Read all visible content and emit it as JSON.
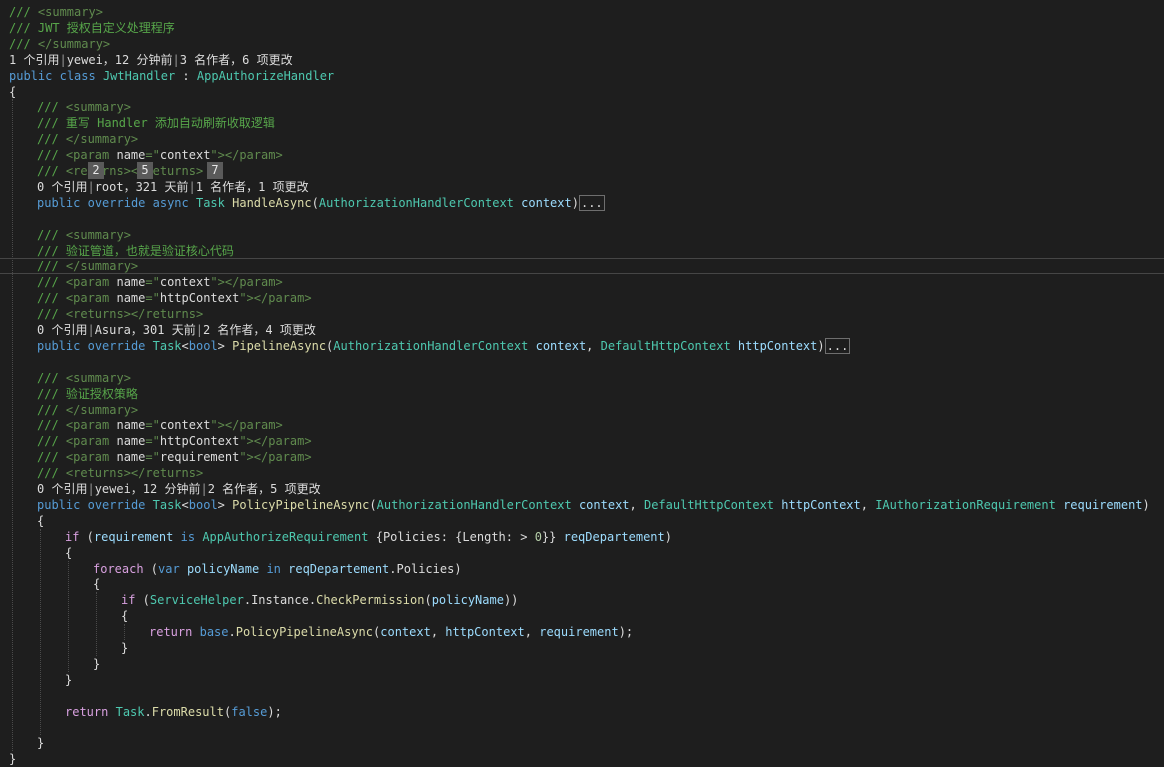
{
  "editor": {
    "lines": [
      {
        "indent": 0,
        "tokens": [
          [
            "/// ",
            "comment"
          ],
          [
            "<summary>",
            "xml"
          ]
        ]
      },
      {
        "indent": 0,
        "tokens": [
          [
            "/// JWT 授权自定义处理程序",
            "comment"
          ]
        ]
      },
      {
        "indent": 0,
        "tokens": [
          [
            "/// ",
            "comment"
          ],
          [
            "</summary>",
            "xml"
          ]
        ]
      },
      {
        "indent": 0,
        "lens": true,
        "tokens": [
          [
            "1 个引用",
            "lens"
          ],
          [
            "|",
            "sep"
          ],
          [
            "yewei，12 分钟前",
            "lens"
          ],
          [
            "|",
            "sep"
          ],
          [
            "3 名作者，6 项更改",
            "lens"
          ]
        ]
      },
      {
        "indent": 0,
        "tokens": [
          [
            "public",
            "kw"
          ],
          [
            " ",
            "plain"
          ],
          [
            "class",
            "kw"
          ],
          [
            " ",
            "plain"
          ],
          [
            "JwtHandler",
            "type"
          ],
          [
            " : ",
            "plain"
          ],
          [
            "AppAuthorizeHandler",
            "type"
          ]
        ]
      },
      {
        "indent": 0,
        "tokens": [
          [
            "{",
            "plain"
          ]
        ]
      },
      {
        "indent": 1,
        "tokens": [
          [
            "/// ",
            "comment"
          ],
          [
            "<summary>",
            "xml"
          ]
        ]
      },
      {
        "indent": 1,
        "tokens": [
          [
            "/// 重写 Handler 添加自动刷新收取逻辑",
            "comment"
          ]
        ]
      },
      {
        "indent": 1,
        "tokens": [
          [
            "/// ",
            "comment"
          ],
          [
            "</summary>",
            "xml"
          ]
        ]
      },
      {
        "indent": 1,
        "tokens": [
          [
            "/// ",
            "comment"
          ],
          [
            "<param ",
            "xml"
          ],
          [
            "name",
            "plain"
          ],
          [
            "=\"",
            "xml"
          ],
          [
            "context",
            "plain"
          ],
          [
            "\"></param>",
            "xml"
          ]
        ]
      },
      {
        "indent": 1,
        "tokens": [
          [
            "/// ",
            "comment"
          ],
          [
            "<returns></returns>",
            "xml"
          ]
        ]
      },
      {
        "indent": 1,
        "lens": true,
        "tokens": [
          [
            "0 个引用",
            "lens"
          ],
          [
            "|",
            "sep"
          ],
          [
            "root，321 天前",
            "lens"
          ],
          [
            "|",
            "sep"
          ],
          [
            "1 名作者，1 项更改",
            "lens"
          ]
        ]
      },
      {
        "indent": 1,
        "tokens": [
          [
            "public",
            "kw"
          ],
          [
            " ",
            "plain"
          ],
          [
            "override",
            "kw"
          ],
          [
            " ",
            "plain"
          ],
          [
            "async",
            "kw"
          ],
          [
            " ",
            "plain"
          ],
          [
            "Task",
            "type"
          ],
          [
            " ",
            "plain"
          ],
          [
            "HandleAsync",
            "method"
          ],
          [
            "(",
            "plain"
          ],
          [
            "AuthorizationHandlerContext",
            "type"
          ],
          [
            " ",
            "plain"
          ],
          [
            "context",
            "var"
          ],
          [
            ")",
            "plain"
          ],
          [
            "...",
            "fold"
          ]
        ]
      },
      {
        "indent": 0,
        "tokens": []
      },
      {
        "indent": 1,
        "tokens": [
          [
            "/// ",
            "comment"
          ],
          [
            "<summary>",
            "xml"
          ]
        ]
      },
      {
        "indent": 1,
        "tokens": [
          [
            "/// 验证管道，也就是验证核心代码",
            "comment"
          ]
        ]
      },
      {
        "indent": 1,
        "highlight": true,
        "tokens": [
          [
            "/// ",
            "comment"
          ],
          [
            "</summary>",
            "xml"
          ]
        ]
      },
      {
        "indent": 1,
        "tokens": [
          [
            "/// ",
            "comment"
          ],
          [
            "<param ",
            "xml"
          ],
          [
            "name",
            "plain"
          ],
          [
            "=\"",
            "xml"
          ],
          [
            "context",
            "plain"
          ],
          [
            "\"></param>",
            "xml"
          ]
        ]
      },
      {
        "indent": 1,
        "tokens": [
          [
            "/// ",
            "comment"
          ],
          [
            "<param ",
            "xml"
          ],
          [
            "name",
            "plain"
          ],
          [
            "=\"",
            "xml"
          ],
          [
            "httpContext",
            "plain"
          ],
          [
            "\"></param>",
            "xml"
          ]
        ]
      },
      {
        "indent": 1,
        "tokens": [
          [
            "/// ",
            "comment"
          ],
          [
            "<returns></returns>",
            "xml"
          ]
        ]
      },
      {
        "indent": 1,
        "lens": true,
        "tokens": [
          [
            "0 个引用",
            "lens"
          ],
          [
            "|",
            "sep"
          ],
          [
            "Asura，301 天前",
            "lens"
          ],
          [
            "|",
            "sep"
          ],
          [
            "2 名作者，4 项更改",
            "lens"
          ]
        ]
      },
      {
        "indent": 1,
        "tokens": [
          [
            "public",
            "kw"
          ],
          [
            " ",
            "plain"
          ],
          [
            "override",
            "kw"
          ],
          [
            " ",
            "plain"
          ],
          [
            "Task",
            "type"
          ],
          [
            "<",
            "plain"
          ],
          [
            "bool",
            "kw"
          ],
          [
            "> ",
            "plain"
          ],
          [
            "PipelineAsync",
            "method"
          ],
          [
            "(",
            "plain"
          ],
          [
            "AuthorizationHandlerContext",
            "type"
          ],
          [
            " ",
            "plain"
          ],
          [
            "context",
            "var"
          ],
          [
            ", ",
            "plain"
          ],
          [
            "DefaultHttpContext",
            "type"
          ],
          [
            " ",
            "plain"
          ],
          [
            "httpContext",
            "var"
          ],
          [
            ")",
            "plain"
          ],
          [
            "...",
            "fold"
          ]
        ]
      },
      {
        "indent": 0,
        "tokens": []
      },
      {
        "indent": 1,
        "tokens": [
          [
            "/// ",
            "comment"
          ],
          [
            "<summary>",
            "xml"
          ]
        ]
      },
      {
        "indent": 1,
        "tokens": [
          [
            "/// 验证授权策略",
            "comment"
          ]
        ]
      },
      {
        "indent": 1,
        "tokens": [
          [
            "/// ",
            "comment"
          ],
          [
            "</summary>",
            "xml"
          ]
        ]
      },
      {
        "indent": 1,
        "tokens": [
          [
            "/// ",
            "comment"
          ],
          [
            "<param ",
            "xml"
          ],
          [
            "name",
            "plain"
          ],
          [
            "=\"",
            "xml"
          ],
          [
            "context",
            "plain"
          ],
          [
            "\"></param>",
            "xml"
          ]
        ]
      },
      {
        "indent": 1,
        "tokens": [
          [
            "/// ",
            "comment"
          ],
          [
            "<param ",
            "xml"
          ],
          [
            "name",
            "plain"
          ],
          [
            "=\"",
            "xml"
          ],
          [
            "httpContext",
            "plain"
          ],
          [
            "\"></param>",
            "xml"
          ]
        ]
      },
      {
        "indent": 1,
        "tokens": [
          [
            "/// ",
            "comment"
          ],
          [
            "<param ",
            "xml"
          ],
          [
            "name",
            "plain"
          ],
          [
            "=\"",
            "xml"
          ],
          [
            "requirement",
            "plain"
          ],
          [
            "\"></param>",
            "xml"
          ]
        ]
      },
      {
        "indent": 1,
        "tokens": [
          [
            "/// ",
            "comment"
          ],
          [
            "<returns></returns>",
            "xml"
          ]
        ]
      },
      {
        "indent": 1,
        "lens": true,
        "tokens": [
          [
            "0 个引用",
            "lens"
          ],
          [
            "|",
            "sep"
          ],
          [
            "yewei，12 分钟前",
            "lens"
          ],
          [
            "|",
            "sep"
          ],
          [
            "2 名作者，5 项更改",
            "lens"
          ]
        ]
      },
      {
        "indent": 1,
        "tokens": [
          [
            "public",
            "kw"
          ],
          [
            " ",
            "plain"
          ],
          [
            "override",
            "kw"
          ],
          [
            " ",
            "plain"
          ],
          [
            "Task",
            "type"
          ],
          [
            "<",
            "plain"
          ],
          [
            "bool",
            "kw"
          ],
          [
            "> ",
            "plain"
          ],
          [
            "PolicyPipelineAsync",
            "method"
          ],
          [
            "(",
            "plain"
          ],
          [
            "AuthorizationHandlerContext",
            "type"
          ],
          [
            " ",
            "plain"
          ],
          [
            "context",
            "var"
          ],
          [
            ", ",
            "plain"
          ],
          [
            "DefaultHttpContext",
            "type"
          ],
          [
            " ",
            "plain"
          ],
          [
            "httpContext",
            "var"
          ],
          [
            ", ",
            "plain"
          ],
          [
            "IAuthorizationRequirement",
            "type"
          ],
          [
            " ",
            "plain"
          ],
          [
            "requirement",
            "var"
          ],
          [
            ")",
            "plain"
          ]
        ]
      },
      {
        "indent": 1,
        "tokens": [
          [
            "{",
            "plain"
          ]
        ]
      },
      {
        "indent": 2,
        "tokens": [
          [
            "if",
            "ctl"
          ],
          [
            " (",
            "plain"
          ],
          [
            "requirement",
            "var"
          ],
          [
            " ",
            "plain"
          ],
          [
            "is",
            "kw"
          ],
          [
            " ",
            "plain"
          ],
          [
            "AppAuthorizeRequirement",
            "type"
          ],
          [
            " {",
            "plain"
          ],
          [
            "Policies",
            "plain"
          ],
          [
            ": {",
            "plain"
          ],
          [
            "Length",
            "plain"
          ],
          [
            ": > ",
            "plain"
          ],
          [
            "0",
            "num"
          ],
          [
            "}} ",
            "plain"
          ],
          [
            "reqDepartement",
            "var"
          ],
          [
            ")",
            "plain"
          ]
        ]
      },
      {
        "indent": 2,
        "tokens": [
          [
            "{",
            "plain"
          ]
        ]
      },
      {
        "indent": 3,
        "tokens": [
          [
            "foreach",
            "ctl"
          ],
          [
            " (",
            "plain"
          ],
          [
            "var",
            "kw"
          ],
          [
            " ",
            "plain"
          ],
          [
            "policyName",
            "var"
          ],
          [
            " ",
            "plain"
          ],
          [
            "in",
            "kw"
          ],
          [
            " ",
            "plain"
          ],
          [
            "reqDepartement",
            "var"
          ],
          [
            ".",
            "plain"
          ],
          [
            "Policies",
            "plain"
          ],
          [
            ")",
            "plain"
          ]
        ]
      },
      {
        "indent": 3,
        "tokens": [
          [
            "{",
            "plain"
          ]
        ]
      },
      {
        "indent": 4,
        "tokens": [
          [
            "if",
            "ctl"
          ],
          [
            " (",
            "plain"
          ],
          [
            "ServiceHelper",
            "type"
          ],
          [
            ".",
            "plain"
          ],
          [
            "Instance",
            "plain"
          ],
          [
            ".",
            "plain"
          ],
          [
            "CheckPermission",
            "method"
          ],
          [
            "(",
            "plain"
          ],
          [
            "policyName",
            "var"
          ],
          [
            "))",
            "plain"
          ]
        ]
      },
      {
        "indent": 4,
        "tokens": [
          [
            "{",
            "plain"
          ]
        ]
      },
      {
        "indent": 5,
        "tokens": [
          [
            "return",
            "ctl"
          ],
          [
            " ",
            "plain"
          ],
          [
            "base",
            "kw"
          ],
          [
            ".",
            "plain"
          ],
          [
            "PolicyPipelineAsync",
            "method"
          ],
          [
            "(",
            "plain"
          ],
          [
            "context",
            "var"
          ],
          [
            ", ",
            "plain"
          ],
          [
            "httpContext",
            "var"
          ],
          [
            ", ",
            "plain"
          ],
          [
            "requirement",
            "var"
          ],
          [
            ");",
            "plain"
          ]
        ]
      },
      {
        "indent": 4,
        "tokens": [
          [
            "}",
            "plain"
          ]
        ]
      },
      {
        "indent": 3,
        "tokens": [
          [
            "}",
            "plain"
          ]
        ]
      },
      {
        "indent": 2,
        "tokens": [
          [
            "}",
            "plain"
          ]
        ]
      },
      {
        "indent": 0,
        "tokens": []
      },
      {
        "indent": 2,
        "tokens": [
          [
            "return",
            "ctl"
          ],
          [
            " ",
            "plain"
          ],
          [
            "Task",
            "type"
          ],
          [
            ".",
            "plain"
          ],
          [
            "FromResult",
            "method"
          ],
          [
            "(",
            "plain"
          ],
          [
            "false",
            "kw"
          ],
          [
            ");",
            "plain"
          ]
        ]
      },
      {
        "indent": 0,
        "tokens": []
      },
      {
        "indent": 1,
        "tokens": [
          [
            "}",
            "plain"
          ]
        ]
      },
      {
        "indent": 0,
        "tokens": [
          [
            "}",
            "plain"
          ]
        ]
      }
    ],
    "badges": [
      {
        "label": "2",
        "line": 10,
        "col": 3
      },
      {
        "label": "5",
        "line": 10,
        "col": 10
      },
      {
        "label": "7",
        "line": 10,
        "col": 20
      }
    ],
    "colors": {
      "background": "#1e1e1e",
      "comment": "#57a64a",
      "keyword": "#569cd6",
      "control": "#d8a0df",
      "type": "#4ec9b0",
      "method": "#dcdcaa",
      "variable": "#9cdcfe",
      "number": "#b5cea8",
      "text": "#dcdcdc"
    }
  }
}
